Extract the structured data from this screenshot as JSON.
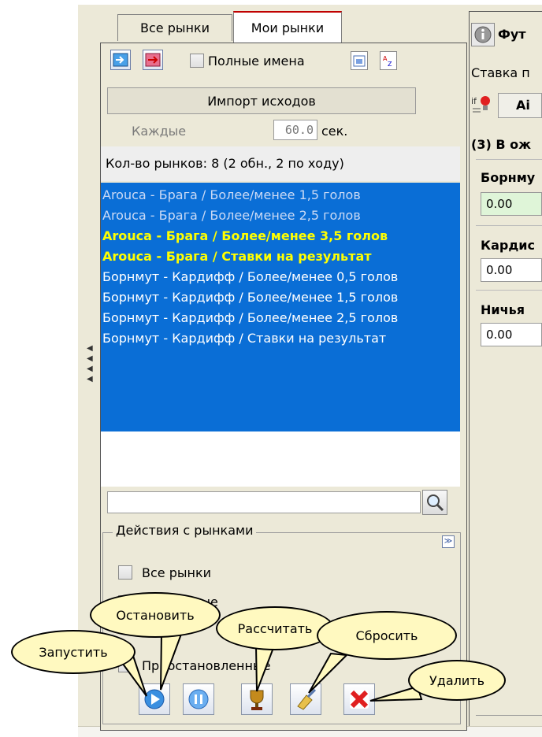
{
  "tabs": {
    "all_markets": "Все рынки",
    "my_markets": "Мои рынки"
  },
  "toolbar": {
    "full_names_label": "Полные имена"
  },
  "import": {
    "button_label": "Импорт исходов",
    "every_label": "Каждые",
    "interval_value": "60.0",
    "unit_label": "сек."
  },
  "market_count_text": "Кол-во рынков: 8 (2 обн., 2 по ходу)",
  "markets": [
    {
      "text": "Arouca - Брага / Более/менее 1,5 голов",
      "style": "dim"
    },
    {
      "text": "Arouca - Брага / Более/менее 2,5 голов",
      "style": "dim"
    },
    {
      "text": "Arouca - Брага / Более/менее 3,5 голов",
      "style": "bold"
    },
    {
      "text": "Arouca - Брага / Ставки на результат",
      "style": "bold"
    },
    {
      "text": "Борнмут - Кардифф / Более/менее 0,5 голов",
      "style": "normal"
    },
    {
      "text": "Борнмут - Кардифф / Более/менее 1,5 голов",
      "style": "normal"
    },
    {
      "text": "Борнмут - Кардифф / Более/менее 2,5 голов",
      "style": "normal"
    },
    {
      "text": "Борнмут - Кардифф / Ставки на результат",
      "style": "normal"
    }
  ],
  "search": {
    "value": ""
  },
  "actions": {
    "title": "Действия с рынками",
    "all_markets": "Все рынки",
    "selected": "Выбранные",
    "stopped": "Приостановленные"
  },
  "callouts": {
    "start": "Запустить",
    "stop": "Остановить",
    "calculate": "Рассчитать",
    "reset": "Сбросить",
    "delete": "Удалить"
  },
  "right_panel": {
    "header": "Фут",
    "bet_label": "Ставка п",
    "button_label": "Аі",
    "section": "(3) В ож",
    "rows": [
      {
        "name": "Борнму",
        "value": "0.00"
      },
      {
        "name": "Кардис",
        "value": "0.00"
      },
      {
        "name": "Ничья",
        "value": "0.00"
      }
    ]
  },
  "colors": {
    "list_bg": "#0a6ed6",
    "highlight": "#ffff00",
    "callout_bg": "#fff9c0",
    "active_tab_border": "#c00000"
  }
}
